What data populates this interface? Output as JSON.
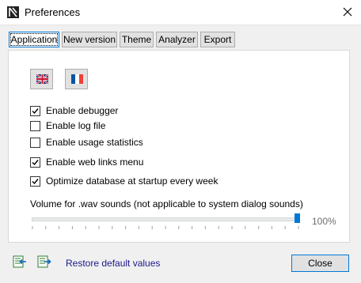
{
  "window": {
    "title": "Preferences"
  },
  "tabs": [
    {
      "label": "Application",
      "active": true
    },
    {
      "label": "New version"
    },
    {
      "label": "Theme"
    },
    {
      "label": "Analyzer"
    },
    {
      "label": "Export"
    }
  ],
  "language_buttons": [
    {
      "icon": "uk-flag-icon"
    },
    {
      "icon": "france-flag-icon"
    }
  ],
  "options": [
    {
      "label": "Enable debugger",
      "checked": true
    },
    {
      "label": "Enable log file",
      "checked": false
    },
    {
      "label": "Enable usage statistics",
      "checked": false
    },
    {
      "label": "Enable web links menu",
      "checked": true
    },
    {
      "label": "Optimize database at startup every week",
      "checked": true
    }
  ],
  "volume": {
    "label": "Volume for .wav sounds (not applicable to system dialog sounds)",
    "value_text": "100%",
    "level": 1.0
  },
  "footer": {
    "import_icon": "import-settings-icon",
    "export_icon": "export-settings-icon",
    "restore_label": "Restore default values",
    "close_label": "Close"
  },
  "colors": {
    "accent": "#0078d7",
    "link": "#1a1a8c"
  }
}
